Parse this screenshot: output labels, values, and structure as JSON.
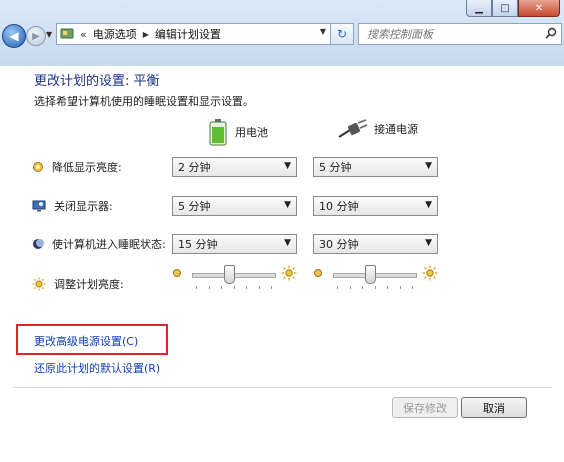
{
  "addressbar": {
    "crumbs": [
      "电源选项",
      "编辑计划设置"
    ],
    "search_placeholder": "搜索控制面板"
  },
  "page": {
    "title": "更改计划的设置: 平衡",
    "description": "选择希望计算机使用的睡眠设置和显示设置。"
  },
  "columns": {
    "battery": "用电池",
    "plugged_in": "接通电源"
  },
  "rows": [
    {
      "label": "降低显示亮度:",
      "battery": "2 分钟",
      "plugged_in": "5 分钟"
    },
    {
      "label": "关闭显示器:",
      "battery": "5 分钟",
      "plugged_in": "10 分钟"
    },
    {
      "label": "使计算机进入睡眠状态:",
      "battery": "15 分钟",
      "plugged_in": "30 分钟"
    }
  ],
  "brightness": {
    "label": "调整计划亮度:",
    "battery_level": 0.45,
    "plugged_in_level": 0.45
  },
  "links": {
    "advanced": "更改高级电源设置(C)",
    "restore": "还原此计划的默认设置(R)"
  },
  "buttons": {
    "save": "保存修改",
    "cancel": "取消"
  },
  "colors": {
    "title": "#1e3287",
    "link": "#0f3fb1",
    "highlight": "#e3222a"
  }
}
